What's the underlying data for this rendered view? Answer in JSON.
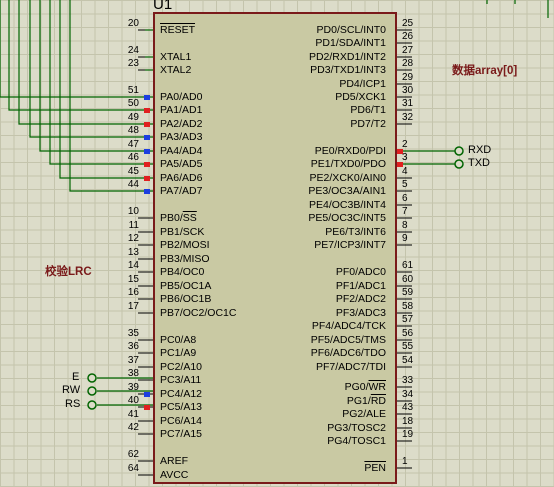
{
  "chip": {
    "name": "U1",
    "left_pins": [
      {
        "num": "20",
        "label": "RESET"
      },
      {
        "num": "24",
        "label": "XTAL1"
      },
      {
        "num": "23",
        "label": "XTAL2"
      },
      {
        "num": "51",
        "label": "PA0/AD0"
      },
      {
        "num": "50",
        "label": "PA1/AD1"
      },
      {
        "num": "49",
        "label": "PA2/AD2"
      },
      {
        "num": "48",
        "label": "PA3/AD3"
      },
      {
        "num": "47",
        "label": "PA4/AD4"
      },
      {
        "num": "46",
        "label": "PA5/AD5"
      },
      {
        "num": "45",
        "label": "PA6/AD6"
      },
      {
        "num": "44",
        "label": "PA7/AD7"
      },
      {
        "num": "10",
        "label": "PB0/SS"
      },
      {
        "num": "11",
        "label": "PB1/SCK"
      },
      {
        "num": "12",
        "label": "PB2/MOSI"
      },
      {
        "num": "13",
        "label": "PB3/MISO"
      },
      {
        "num": "14",
        "label": "PB4/OC0"
      },
      {
        "num": "15",
        "label": "PB5/OC1A"
      },
      {
        "num": "16",
        "label": "PB6/OC1B"
      },
      {
        "num": "17",
        "label": "PB7/OC2/OC1C"
      },
      {
        "num": "35",
        "label": "PC0/A8"
      },
      {
        "num": "36",
        "label": "PC1/A9"
      },
      {
        "num": "37",
        "label": "PC2/A10"
      },
      {
        "num": "38",
        "label": "PC3/A11"
      },
      {
        "num": "39",
        "label": "PC4/A12"
      },
      {
        "num": "40",
        "label": "PC5/A13"
      },
      {
        "num": "41",
        "label": "PC6/A14"
      },
      {
        "num": "42",
        "label": "PC7/A15"
      },
      {
        "num": "62",
        "label": "AREF"
      },
      {
        "num": "64",
        "label": "AVCC"
      }
    ],
    "right_pins": [
      {
        "num": "25",
        "label": "PD0/SCL/INT0"
      },
      {
        "num": "26",
        "label": "PD1/SDA/INT1"
      },
      {
        "num": "27",
        "label": "PD2/RXD1/INT2"
      },
      {
        "num": "28",
        "label": "PD3/TXD1/INT3"
      },
      {
        "num": "29",
        "label": "PD4/ICP1"
      },
      {
        "num": "30",
        "label": "PD5/XCK1"
      },
      {
        "num": "31",
        "label": "PD6/T1"
      },
      {
        "num": "32",
        "label": "PD7/T2"
      },
      {
        "num": "2",
        "label": "PE0/RXD0/PDI"
      },
      {
        "num": "3",
        "label": "PE1/TXD0/PDO"
      },
      {
        "num": "4",
        "label": "PE2/XCK0/AIN0"
      },
      {
        "num": "5",
        "label": "PE3/OC3A/AIN1"
      },
      {
        "num": "6",
        "label": "PE4/OC3B/INT4"
      },
      {
        "num": "7",
        "label": "PE5/OC3C/INT5"
      },
      {
        "num": "8",
        "label": "PE6/T3/INT6"
      },
      {
        "num": "9",
        "label": "PE7/ICP3/INT7"
      },
      {
        "num": "61",
        "label": "PF0/ADC0"
      },
      {
        "num": "60",
        "label": "PF1/ADC1"
      },
      {
        "num": "59",
        "label": "PF2/ADC2"
      },
      {
        "num": "58",
        "label": "PF3/ADC3"
      },
      {
        "num": "57",
        "label": "PF4/ADC4/TCK"
      },
      {
        "num": "56",
        "label": "PF5/ADC5/TMS"
      },
      {
        "num": "55",
        "label": "PF6/ADC6/TDO"
      },
      {
        "num": "54",
        "label": "PF7/ADC7/TDI"
      },
      {
        "num": "33",
        "label": "PG0/WR"
      },
      {
        "num": "34",
        "label": "PG1/RD"
      },
      {
        "num": "43",
        "label": "PG2/ALE"
      },
      {
        "num": "18",
        "label": "PG3/TOSC2"
      },
      {
        "num": "19",
        "label": "PG4/TOSC1"
      },
      {
        "num": "1",
        "label": "PEN"
      }
    ]
  },
  "terminals": {
    "rxd": "RXD",
    "txd": "TXD",
    "e": "E",
    "rw": "RW",
    "rs": "RS"
  },
  "annotations": {
    "data_array": "数据array[0]",
    "checksum": "校验LRC"
  },
  "colors": {
    "wire": "#006400",
    "chip_fill": "#c9c9a3",
    "chip_border": "#7a1a1a",
    "pin_red": "#e02020",
    "pin_blue": "#1d3ee0",
    "annotation": "#7a1a1a"
  }
}
